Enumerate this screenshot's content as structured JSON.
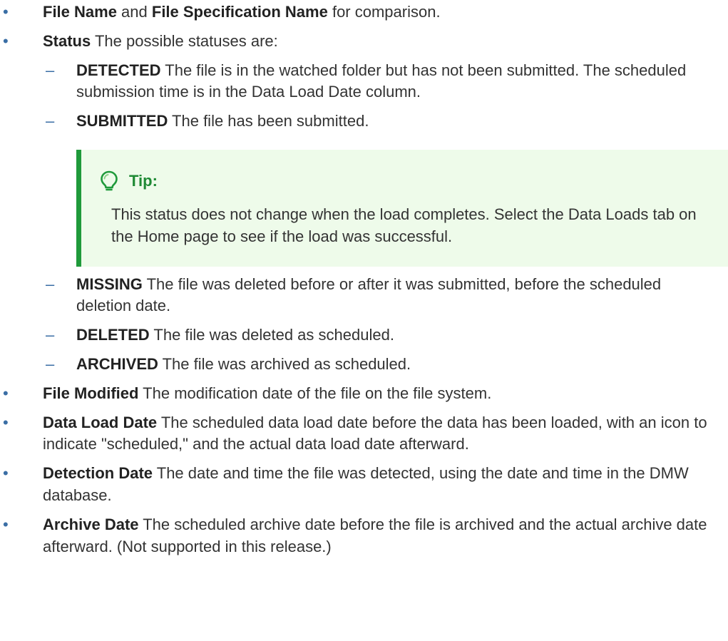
{
  "items": [
    {
      "label": "File Name",
      "connector": " and ",
      "label2": "File Specification Name",
      "text": " for comparison."
    },
    {
      "label": "Status",
      "text": " The possible statuses are:"
    }
  ],
  "statuses_a": [
    {
      "label": "DETECTED",
      "text": " The file is in the watched folder but has not been submitted. The scheduled submission time is in the Data Load Date column."
    },
    {
      "label": "SUBMITTED",
      "text": " The file has been submitted."
    }
  ],
  "tip": {
    "title": "Tip:",
    "icon": "lightbulb-icon",
    "accent_color": "#1f9a3b",
    "background_color": "#eefbea",
    "text": "This status does not change when the load completes. Select the Data Loads tab on the Home page to see if the load was successful."
  },
  "statuses_b": [
    {
      "label": "MISSING",
      "text": " The file was deleted before or after it was submitted, before the scheduled deletion date."
    },
    {
      "label": "DELETED",
      "text": " The file was deleted as scheduled."
    },
    {
      "label": "ARCHIVED",
      "text": " The file was archived as scheduled."
    }
  ],
  "items_after": [
    {
      "label": "File Modified",
      "text": " The modification date of the file on the file system."
    },
    {
      "label": "Data Load Date",
      "text": " The scheduled data load date before the data has been loaded, with an icon to indicate \"scheduled,\" and the actual data load date afterward."
    },
    {
      "label": "Detection Date",
      "text": " The date and time the file was detected, using the date and time in the DMW database."
    },
    {
      "label": "Archive Date",
      "text": " The scheduled archive date before the file is archived and the actual archive date afterward. (Not supported in this release.)"
    }
  ],
  "markers": {
    "bullet": "•",
    "dash": "–"
  }
}
